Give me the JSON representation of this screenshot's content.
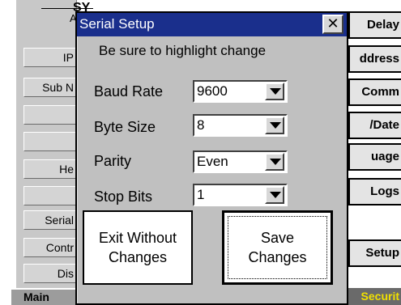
{
  "background": {
    "system_group": {
      "title": "SY",
      "subtitle": "Ala"
    },
    "left_items": [
      {
        "label": "IP"
      },
      {
        "label": "Sub N"
      },
      {
        "label": ""
      },
      {
        "label": ""
      },
      {
        "label": "He"
      },
      {
        "label": ""
      },
      {
        "label": "Serial"
      },
      {
        "label": "Contr"
      },
      {
        "label": "Dis"
      }
    ],
    "right_buttons": [
      {
        "label": "Delay"
      },
      {
        "label": "ddress"
      },
      {
        "label": "Comm"
      },
      {
        "label": "/Date"
      },
      {
        "label": "uage"
      },
      {
        "label": "Logs"
      },
      {
        "label": "Setup"
      }
    ],
    "bottom_tabs": {
      "main": "Main",
      "security": "Securit"
    }
  },
  "dialog": {
    "title": "Serial Setup",
    "close_glyph": "✕",
    "hint": "Be sure to highlight change",
    "fields": [
      {
        "label": "Baud Rate",
        "value": "9600"
      },
      {
        "label": "Byte Size",
        "value": "8"
      },
      {
        "label": "Parity",
        "value": "Even"
      },
      {
        "label": "Stop Bits",
        "value": "1"
      }
    ],
    "exit_button": "Exit Without\nChanges",
    "save_button": "Save\nChanges"
  },
  "colors": {
    "title_bar": "#1a2f8c",
    "dialog_bg": "#c0c0c0",
    "security_text": "#f0e000"
  }
}
